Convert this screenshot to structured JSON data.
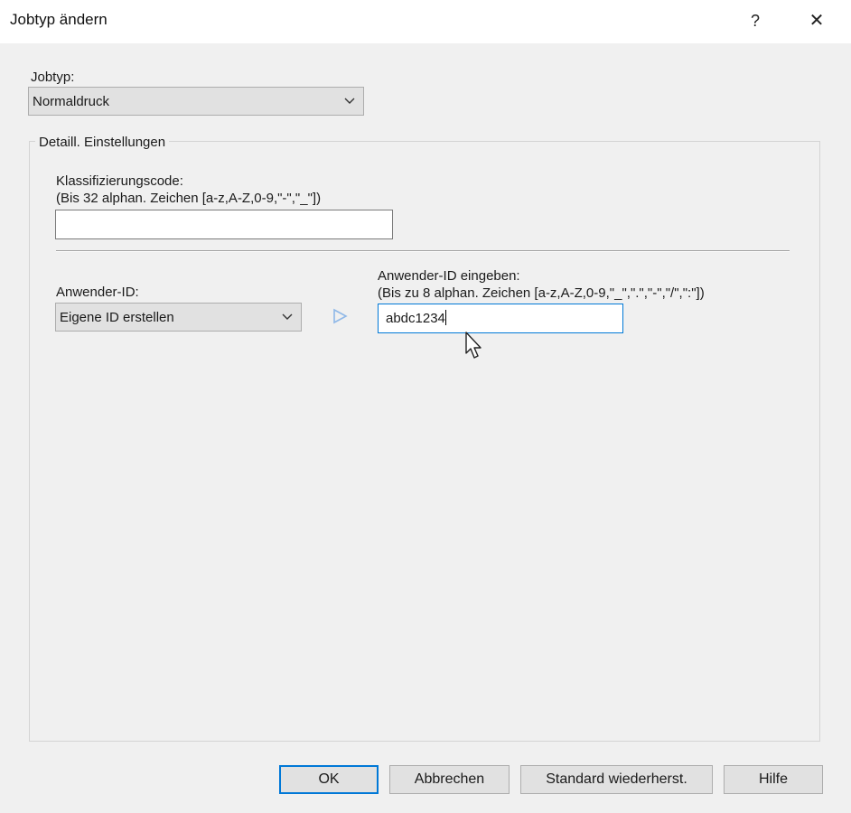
{
  "window": {
    "title": "Jobtyp ändern",
    "help_label": "?",
    "close_label": "✕"
  },
  "jobtype": {
    "label": "Jobtyp:",
    "selected": "Normaldruck"
  },
  "details": {
    "group_title": "Detaill. Einstellungen",
    "classification": {
      "label": "Klassifizierungscode:",
      "hint": "(Bis 32 alphan. Zeichen [a-z,A-Z,0-9,\"-\",\"_\"])",
      "value": ""
    },
    "user_id": {
      "label": "Anwender-ID:",
      "selected": "Eigene ID erstellen",
      "entry_label": "Anwender-ID eingeben:",
      "entry_hint": "(Bis zu 8 alphan. Zeichen [a-z,A-Z,0-9,\"_\",\".\",\"-\",\"/\",\":\"])",
      "value": "abdc1234"
    }
  },
  "buttons": {
    "ok": "OK",
    "cancel": "Abbrechen",
    "restore": "Standard wiederherst.",
    "help": "Hilfe"
  },
  "colors": {
    "accent": "#0078d7",
    "arrow": "#8fb8e8"
  }
}
